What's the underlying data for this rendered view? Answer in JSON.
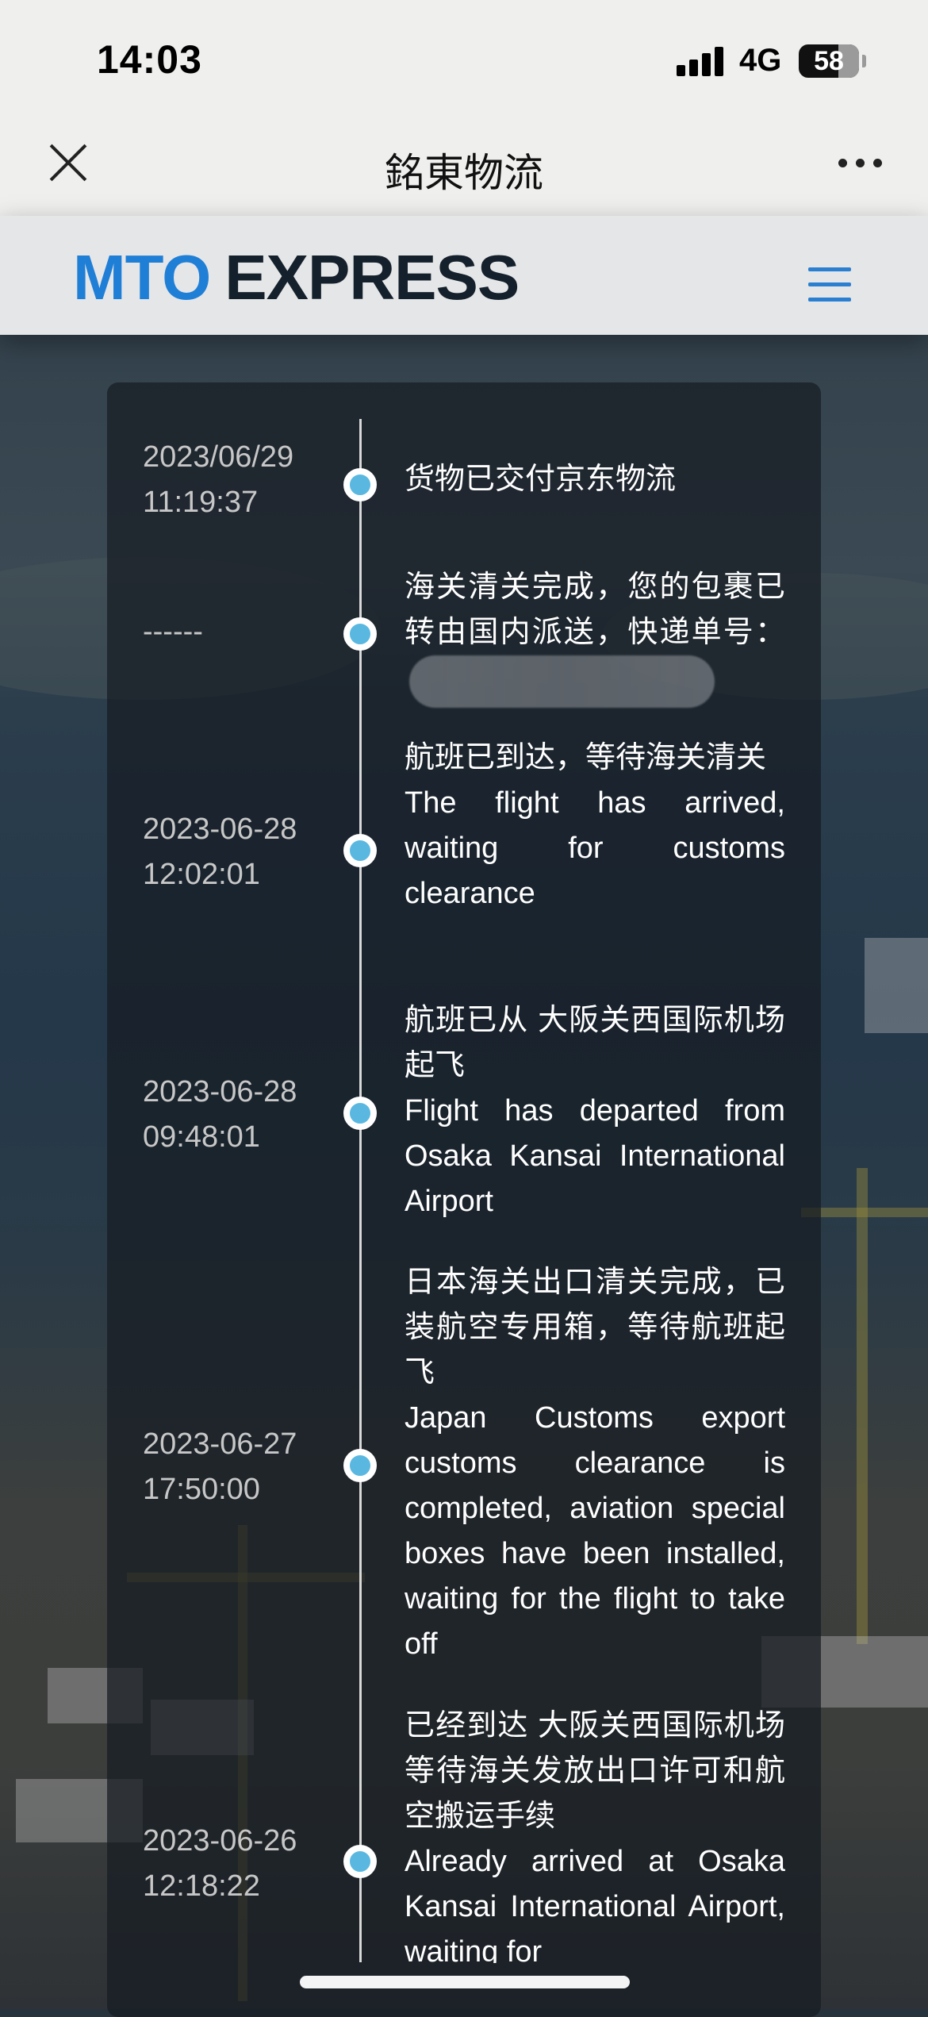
{
  "status_bar": {
    "time": "14:03",
    "network": "4G",
    "battery": "58",
    "battery_level": 0.58
  },
  "nav_bar": {
    "title": "銘東物流"
  },
  "site": {
    "logo_left": "MTO",
    "logo_right": "EXPRESS",
    "brand_color": "#1f7fd6"
  },
  "timeline": {
    "events": [
      {
        "date": "2023/06/29",
        "time": "11:19:37",
        "lines": [
          "货物已交付京东物流"
        ]
      },
      {
        "date": "------",
        "time": "",
        "lines": [
          "海关清关完成，您的包裹已转由国内派送，快递单号："
        ],
        "has_redacted_tracking_number": true
      },
      {
        "date": "2023-06-28",
        "time": "12:02:01",
        "lines": [
          "航班已到达，等待海关清关",
          "The flight has arrived, waiting for customs clearance"
        ]
      },
      {
        "date": "2023-06-28",
        "time": "09:48:01",
        "lines": [
          "航班已从 大阪关西国际机场 起飞",
          "Flight has departed from Osaka Kansai International Airport"
        ]
      },
      {
        "date": "2023-06-27",
        "time": "17:50:00",
        "lines": [
          "日本海关出口清关完成，已装航空专用箱，等待航班起飞",
          "Japan Customs export customs clearance is completed, aviation special boxes have been installed, waiting for the flight to take off"
        ]
      },
      {
        "date": "2023-06-26",
        "time": "12:18:22",
        "lines": [
          "已经到达 大阪关西国际机场 等待海关发放出口许可和航空搬运手续",
          "Already arrived at Osaka Kansai International Airport, waiting for"
        ]
      }
    ],
    "dot_color": "#5ab8e0"
  }
}
